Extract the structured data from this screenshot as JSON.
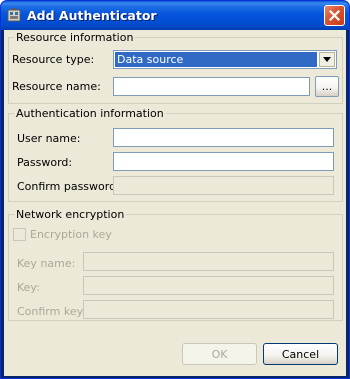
{
  "window": {
    "title": "Add Authenticator"
  },
  "resource": {
    "group_title": "Resource information",
    "type_label": "Resource type:",
    "type_value": "Data source",
    "name_label": "Resource name:",
    "name_value": "",
    "browse_label": "..."
  },
  "auth": {
    "group_title": "Authentication information",
    "user_label": "User name:",
    "user_value": "",
    "password_label": "Password:",
    "password_value": "",
    "confirm_label": "Confirm password:",
    "confirm_value": ""
  },
  "encryption": {
    "group_title": "Network encryption",
    "checkbox_label": "Encryption key",
    "checkbox_checked": false,
    "key_name_label": "Key name:",
    "key_label": "Key:",
    "confirm_key_label": "Confirm key:"
  },
  "buttons": {
    "ok": "OK",
    "cancel": "Cancel"
  },
  "icons": {
    "app": "authenticator-icon",
    "close": "close-icon",
    "dropdown": "chevron-down-icon"
  },
  "colors": {
    "titlebar": "#0554dc",
    "close": "#d8532f",
    "selection": "#316ac5",
    "dialog_bg": "#ece9d8"
  }
}
